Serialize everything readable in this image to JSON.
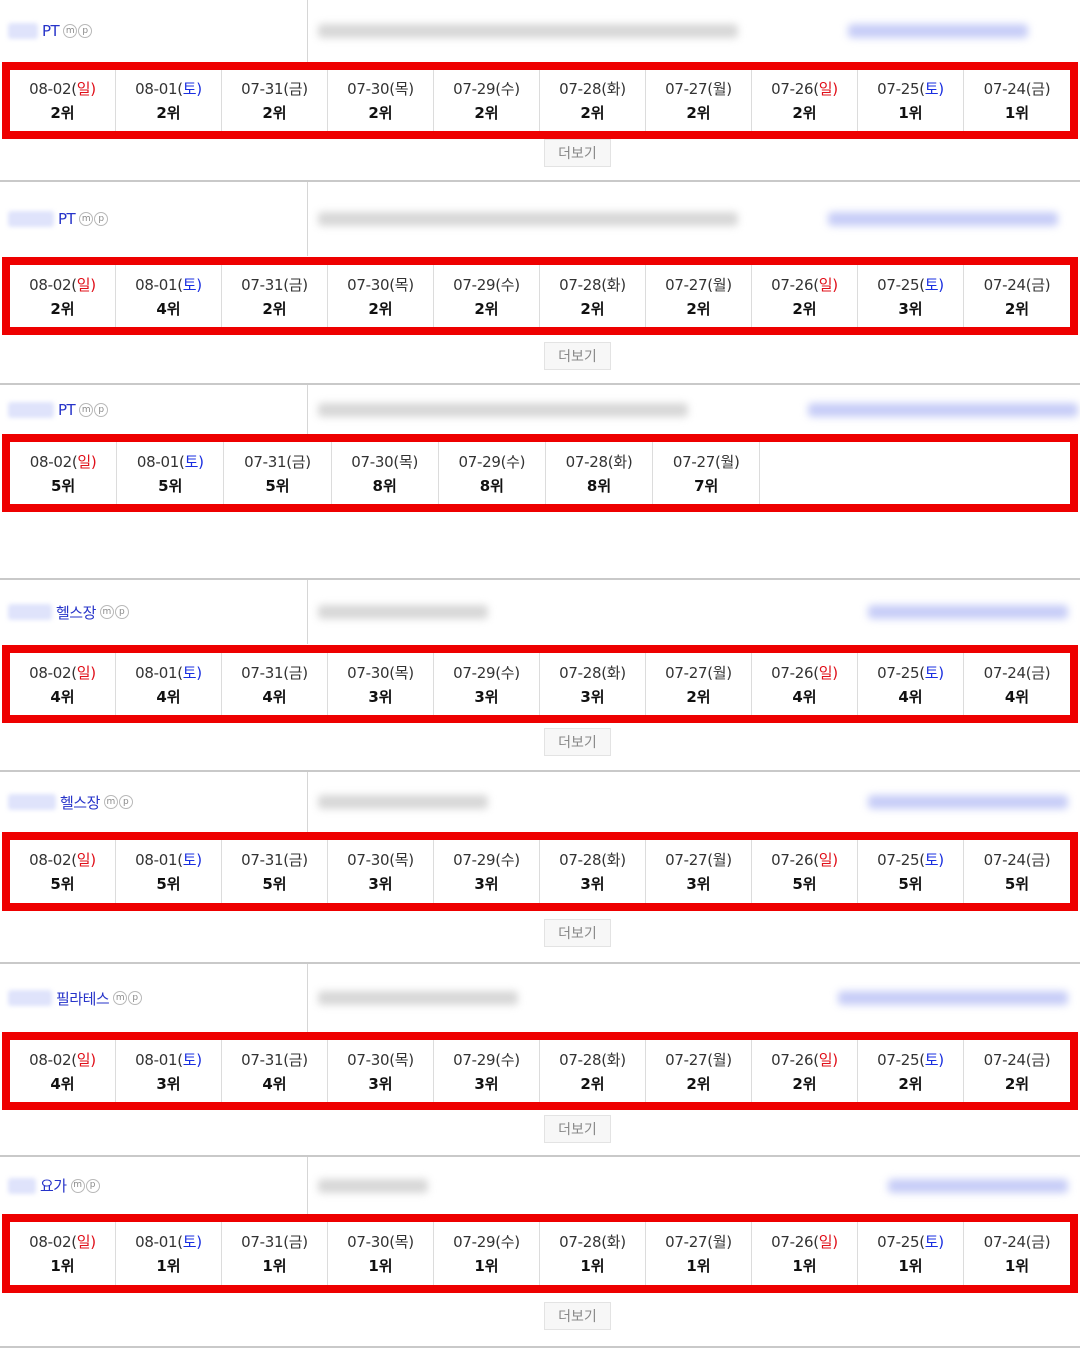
{
  "more_label": "더보기",
  "icon_labels": {
    "m": "m",
    "p": "p"
  },
  "colors": {
    "highlight": "#ee0000",
    "sunday": "#e0101a",
    "saturday": "#1a2fe0",
    "keyword": "#2633c9"
  },
  "sections": [
    {
      "keyword": "PT",
      "has_more": true,
      "cells": [
        {
          "date": "08-02(",
          "wd": "일",
          "type": "sun",
          "rank": "2위"
        },
        {
          "date": "08-01(",
          "wd": "토",
          "type": "sat",
          "rank": "2위"
        },
        {
          "date": "07-31(",
          "wd": "금",
          "type": "wk",
          "rank": "2위"
        },
        {
          "date": "07-30(",
          "wd": "목",
          "type": "wk",
          "rank": "2위"
        },
        {
          "date": "07-29(",
          "wd": "수",
          "type": "wk",
          "rank": "2위"
        },
        {
          "date": "07-28(",
          "wd": "화",
          "type": "wk",
          "rank": "2위"
        },
        {
          "date": "07-27(",
          "wd": "월",
          "type": "wk",
          "rank": "2위"
        },
        {
          "date": "07-26(",
          "wd": "일",
          "type": "sun",
          "rank": "2위"
        },
        {
          "date": "07-25(",
          "wd": "토",
          "type": "sat",
          "rank": "1위"
        },
        {
          "date": "07-24(",
          "wd": "금",
          "type": "wk",
          "rank": "1위"
        }
      ]
    },
    {
      "keyword": "PT",
      "has_more": true,
      "cells": [
        {
          "date": "08-02(",
          "wd": "일",
          "type": "sun",
          "rank": "2위"
        },
        {
          "date": "08-01(",
          "wd": "토",
          "type": "sat",
          "rank": "4위"
        },
        {
          "date": "07-31(",
          "wd": "금",
          "type": "wk",
          "rank": "2위"
        },
        {
          "date": "07-30(",
          "wd": "목",
          "type": "wk",
          "rank": "2위"
        },
        {
          "date": "07-29(",
          "wd": "수",
          "type": "wk",
          "rank": "2위"
        },
        {
          "date": "07-28(",
          "wd": "화",
          "type": "wk",
          "rank": "2위"
        },
        {
          "date": "07-27(",
          "wd": "월",
          "type": "wk",
          "rank": "2위"
        },
        {
          "date": "07-26(",
          "wd": "일",
          "type": "sun",
          "rank": "2위"
        },
        {
          "date": "07-25(",
          "wd": "토",
          "type": "sat",
          "rank": "3위"
        },
        {
          "date": "07-24(",
          "wd": "금",
          "type": "wk",
          "rank": "2위"
        }
      ]
    },
    {
      "keyword": "PT",
      "has_more": false,
      "cells": [
        {
          "date": "08-02(",
          "wd": "일",
          "type": "sun",
          "rank": "5위"
        },
        {
          "date": "08-01(",
          "wd": "토",
          "type": "sat",
          "rank": "5위"
        },
        {
          "date": "07-31(",
          "wd": "금",
          "type": "wk",
          "rank": "5위"
        },
        {
          "date": "07-30(",
          "wd": "목",
          "type": "wk",
          "rank": "8위"
        },
        {
          "date": "07-29(",
          "wd": "수",
          "type": "wk",
          "rank": "8위"
        },
        {
          "date": "07-28(",
          "wd": "화",
          "type": "wk",
          "rank": "8위"
        },
        {
          "date": "07-27(",
          "wd": "월",
          "type": "wk",
          "rank": "7위"
        }
      ]
    },
    {
      "keyword": "헬스장",
      "has_more": true,
      "cells": [
        {
          "date": "08-02(",
          "wd": "일",
          "type": "sun",
          "rank": "4위"
        },
        {
          "date": "08-01(",
          "wd": "토",
          "type": "sat",
          "rank": "4위"
        },
        {
          "date": "07-31(",
          "wd": "금",
          "type": "wk",
          "rank": "4위"
        },
        {
          "date": "07-30(",
          "wd": "목",
          "type": "wk",
          "rank": "3위"
        },
        {
          "date": "07-29(",
          "wd": "수",
          "type": "wk",
          "rank": "3위"
        },
        {
          "date": "07-28(",
          "wd": "화",
          "type": "wk",
          "rank": "3위"
        },
        {
          "date": "07-27(",
          "wd": "월",
          "type": "wk",
          "rank": "2위"
        },
        {
          "date": "07-26(",
          "wd": "일",
          "type": "sun",
          "rank": "4위"
        },
        {
          "date": "07-25(",
          "wd": "토",
          "type": "sat",
          "rank": "4위"
        },
        {
          "date": "07-24(",
          "wd": "금",
          "type": "wk",
          "rank": "4위"
        }
      ]
    },
    {
      "keyword": "헬스장",
      "has_more": true,
      "cells": [
        {
          "date": "08-02(",
          "wd": "일",
          "type": "sun",
          "rank": "5위"
        },
        {
          "date": "08-01(",
          "wd": "토",
          "type": "sat",
          "rank": "5위"
        },
        {
          "date": "07-31(",
          "wd": "금",
          "type": "wk",
          "rank": "5위"
        },
        {
          "date": "07-30(",
          "wd": "목",
          "type": "wk",
          "rank": "3위"
        },
        {
          "date": "07-29(",
          "wd": "수",
          "type": "wk",
          "rank": "3위"
        },
        {
          "date": "07-28(",
          "wd": "화",
          "type": "wk",
          "rank": "3위"
        },
        {
          "date": "07-27(",
          "wd": "월",
          "type": "wk",
          "rank": "3위"
        },
        {
          "date": "07-26(",
          "wd": "일",
          "type": "sun",
          "rank": "5위"
        },
        {
          "date": "07-25(",
          "wd": "토",
          "type": "sat",
          "rank": "5위"
        },
        {
          "date": "07-24(",
          "wd": "금",
          "type": "wk",
          "rank": "5위"
        }
      ]
    },
    {
      "keyword": "필라테스",
      "has_more": true,
      "cells": [
        {
          "date": "08-02(",
          "wd": "일",
          "type": "sun",
          "rank": "4위"
        },
        {
          "date": "08-01(",
          "wd": "토",
          "type": "sat",
          "rank": "3위"
        },
        {
          "date": "07-31(",
          "wd": "금",
          "type": "wk",
          "rank": "4위"
        },
        {
          "date": "07-30(",
          "wd": "목",
          "type": "wk",
          "rank": "3위"
        },
        {
          "date": "07-29(",
          "wd": "수",
          "type": "wk",
          "rank": "3위"
        },
        {
          "date": "07-28(",
          "wd": "화",
          "type": "wk",
          "rank": "2위"
        },
        {
          "date": "07-27(",
          "wd": "월",
          "type": "wk",
          "rank": "2위"
        },
        {
          "date": "07-26(",
          "wd": "일",
          "type": "sun",
          "rank": "2위"
        },
        {
          "date": "07-25(",
          "wd": "토",
          "type": "sat",
          "rank": "2위"
        },
        {
          "date": "07-24(",
          "wd": "금",
          "type": "wk",
          "rank": "2위"
        }
      ]
    },
    {
      "keyword": "요가",
      "has_more": true,
      "cells": [
        {
          "date": "08-02(",
          "wd": "일",
          "type": "sun",
          "rank": "1위"
        },
        {
          "date": "08-01(",
          "wd": "토",
          "type": "sat",
          "rank": "1위"
        },
        {
          "date": "07-31(",
          "wd": "금",
          "type": "wk",
          "rank": "1위"
        },
        {
          "date": "07-30(",
          "wd": "목",
          "type": "wk",
          "rank": "1위"
        },
        {
          "date": "07-29(",
          "wd": "수",
          "type": "wk",
          "rank": "1위"
        },
        {
          "date": "07-28(",
          "wd": "화",
          "type": "wk",
          "rank": "1위"
        },
        {
          "date": "07-27(",
          "wd": "월",
          "type": "wk",
          "rank": "1위"
        },
        {
          "date": "07-26(",
          "wd": "일",
          "type": "sun",
          "rank": "1위"
        },
        {
          "date": "07-25(",
          "wd": "토",
          "type": "sat",
          "rank": "1위"
        },
        {
          "date": "07-24(",
          "wd": "금",
          "type": "wk",
          "rank": "1위"
        }
      ]
    }
  ]
}
